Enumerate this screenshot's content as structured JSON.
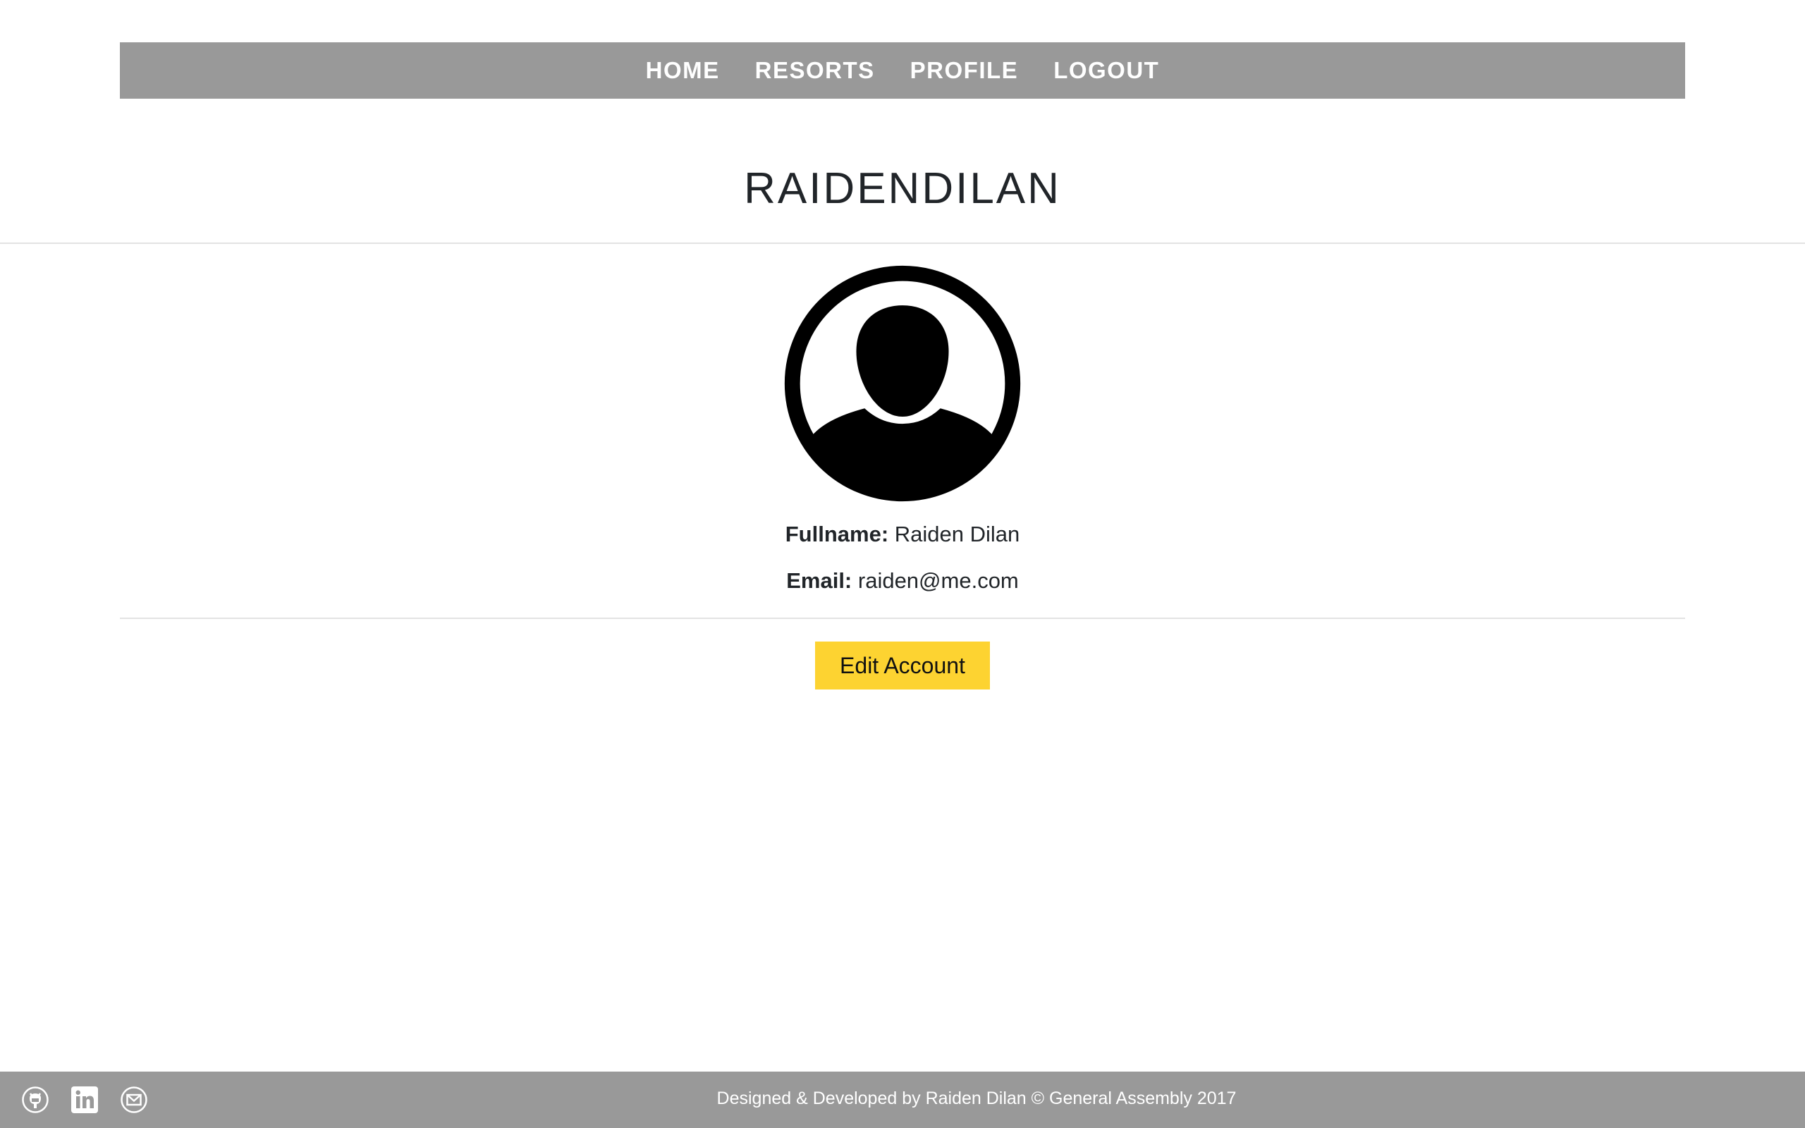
{
  "nav": {
    "items": [
      {
        "label": "HOME"
      },
      {
        "label": "RESORTS"
      },
      {
        "label": "PROFILE"
      },
      {
        "label": "LOGOUT"
      }
    ],
    "background": "#999999"
  },
  "profile": {
    "username": "RAIDENDILAN",
    "avatar_icon": "user-avatar-icon",
    "fullname_label": "Fullname:",
    "fullname_value": "Raiden Dilan",
    "email_label": "Email:",
    "email_value": "raiden@me.com",
    "edit_button_label": "Edit Account",
    "edit_button_color": "#fdd331"
  },
  "footer": {
    "icons": [
      "github-icon",
      "linkedin-icon",
      "mail-icon"
    ],
    "text": "Designed & Developed by Raiden Dilan © General Assembly 2017",
    "background": "#999999"
  }
}
